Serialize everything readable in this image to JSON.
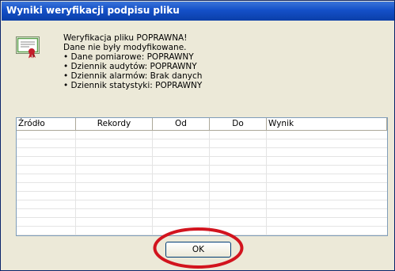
{
  "dialog": {
    "title": "Wyniki weryfikacji podpisu pliku"
  },
  "message": {
    "line1": "Weryfikacja pliku POPRAWNA!",
    "line2": "Dane nie były modyfikowane.",
    "bullets": [
      "Dane pomiarowe: POPRAWNY",
      "Dziennik audytów: POPRAWNY",
      "Dziennik alarmów: Brak danych",
      "Dziennik statystyki: POPRAWNY"
    ]
  },
  "table": {
    "columns": [
      "Źródło",
      "Rekordy",
      "Od",
      "Do",
      "Wynik"
    ],
    "rows": []
  },
  "buttons": {
    "ok_label": "OK"
  },
  "colors": {
    "titlebar": "#1450c8",
    "highlight_ring": "#d2141e"
  },
  "icons": {
    "certificate": "certificate-icon"
  }
}
